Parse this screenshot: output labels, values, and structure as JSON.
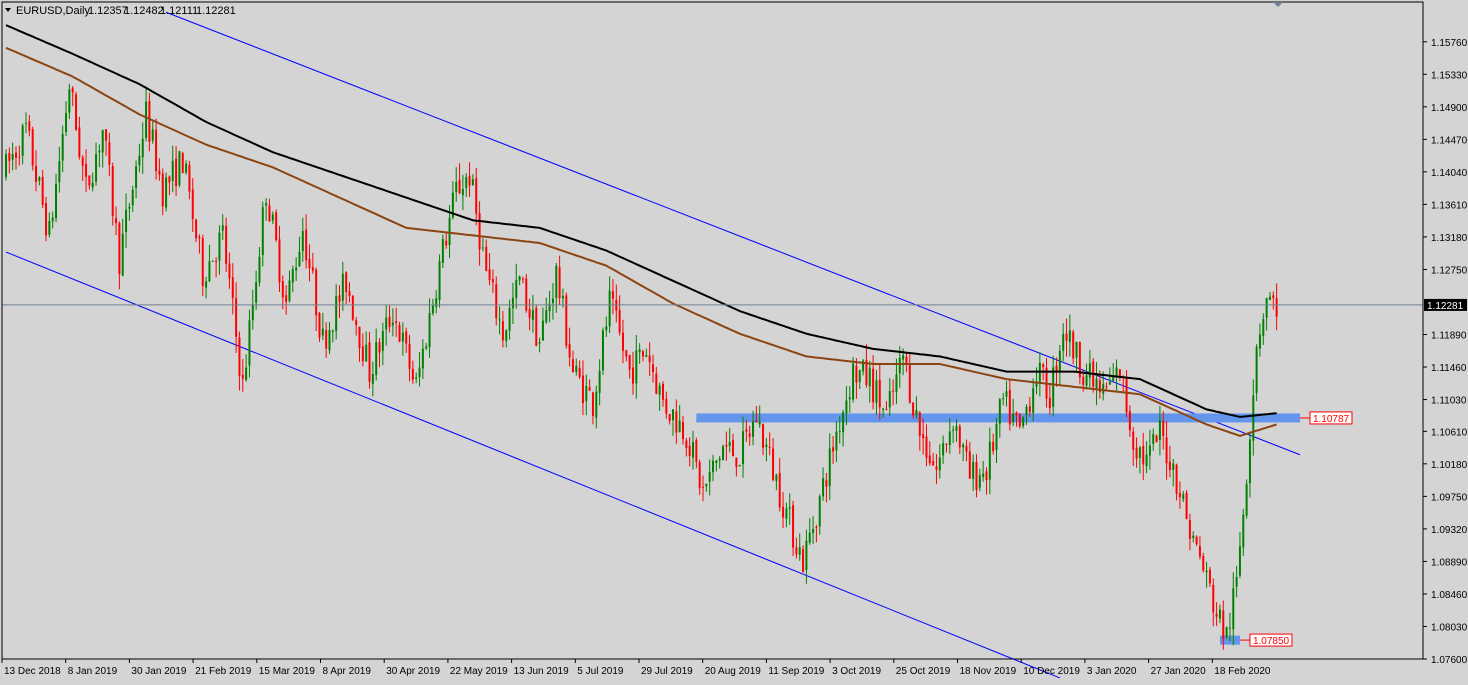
{
  "chart_data": {
    "type": "candlestick",
    "title": "EURUSD,Daily",
    "ohlc_readout": [
      "1.12357",
      "1.12482",
      "1.12111",
      "1.12281"
    ],
    "ylim": [
      1.076,
      1.1618
    ],
    "y_ticks": [
      "1.15760",
      "1.15330",
      "1.14900",
      "1.14470",
      "1.14040",
      "1.13610",
      "1.13180",
      "1.12750",
      "1.12281",
      "1.11890",
      "1.11460",
      "1.11030",
      "1.10610",
      "1.10180",
      "1.09750",
      "1.09320",
      "1.08890",
      "1.08460",
      "1.08030",
      "1.07600"
    ],
    "x_labels": [
      "13 Dec 2018",
      "8 Jan 2019",
      "30 Jan 2019",
      "21 Feb 2019",
      "15 Mar 2019",
      "8 Apr 2019",
      "30 Apr 2019",
      "22 May 2019",
      "13 Jun 2019",
      "5 Jul 2019",
      "29 Jul 2019",
      "20 Aug 2019",
      "11 Sep 2019",
      "3 Oct 2019",
      "25 Oct 2019",
      "18 Nov 2019",
      "10 Dec 2019",
      "3 Jan 2020",
      "27 Jan 2020",
      "18 Feb 2020"
    ],
    "current_price": "1.12281",
    "levels": [
      {
        "label": "1.10787",
        "value": 1.10787
      },
      {
        "label": "1.07850",
        "value": 1.0785
      }
    ],
    "colors": {
      "background": "#d4d4d4",
      "bull": "#008000",
      "bear": "#ff0000",
      "ma_slow": "#000000",
      "ma_fast": "#8b4513",
      "channel": "#0000ff",
      "level_band": "#6495ed",
      "price_line": "#708090",
      "level_label": "#ff0000"
    },
    "anchors": [
      [
        0,
        1.14
      ],
      [
        7,
        1.146
      ],
      [
        14,
        1.132
      ],
      [
        20,
        1.152
      ],
      [
        25,
        1.138
      ],
      [
        30,
        1.146
      ],
      [
        35,
        1.129
      ],
      [
        43,
        1.148
      ],
      [
        48,
        1.138
      ],
      [
        54,
        1.142
      ],
      [
        60,
        1.127
      ],
      [
        66,
        1.132
      ],
      [
        72,
        1.112
      ],
      [
        79,
        1.138
      ],
      [
        85,
        1.123
      ],
      [
        90,
        1.133
      ],
      [
        96,
        1.118
      ],
      [
        103,
        1.126
      ],
      [
        110,
        1.114
      ],
      [
        117,
        1.122
      ],
      [
        124,
        1.112
      ],
      [
        131,
        1.128
      ],
      [
        136,
        1.138
      ],
      [
        140,
        1.14
      ],
      [
        145,
        1.127
      ],
      [
        150,
        1.119
      ],
      [
        155,
        1.126
      ],
      [
        161,
        1.118
      ],
      [
        166,
        1.127
      ],
      [
        171,
        1.114
      ],
      [
        177,
        1.11
      ],
      [
        182,
        1.123
      ],
      [
        188,
        1.114
      ],
      [
        193,
        1.117
      ],
      [
        198,
        1.11
      ],
      [
        205,
        1.106
      ],
      [
        210,
        1.098
      ],
      [
        216,
        1.104
      ],
      [
        221,
        1.103
      ],
      [
        226,
        1.108
      ],
      [
        231,
        1.101
      ],
      [
        236,
        1.094
      ],
      [
        240,
        1.089
      ],
      [
        245,
        1.097
      ],
      [
        250,
        1.106
      ],
      [
        255,
        1.114
      ],
      [
        260,
        1.113
      ],
      [
        265,
        1.108
      ],
      [
        270,
        1.116
      ],
      [
        275,
        1.106
      ],
      [
        280,
        1.101
      ],
      [
        285,
        1.108
      ],
      [
        290,
        1.1
      ],
      [
        295,
        1.101
      ],
      [
        300,
        1.11
      ],
      [
        305,
        1.106
      ],
      [
        310,
        1.114
      ],
      [
        314,
        1.111
      ],
      [
        318,
        1.12
      ],
      [
        322,
        1.116
      ],
      [
        326,
        1.113
      ],
      [
        330,
        1.111
      ],
      [
        335,
        1.114
      ],
      [
        339,
        1.105
      ],
      [
        343,
        1.102
      ],
      [
        347,
        1.106
      ],
      [
        352,
        1.1
      ],
      [
        356,
        1.093
      ],
      [
        360,
        1.088
      ],
      [
        364,
        1.082
      ],
      [
        367,
        1.079
      ],
      [
        370,
        1.086
      ],
      [
        373,
        1.101
      ],
      [
        376,
        1.118
      ],
      [
        379,
        1.124
      ],
      [
        381,
        1.1228
      ]
    ],
    "ma_slow_anchors": [
      [
        0,
        1.1598
      ],
      [
        20,
        1.156
      ],
      [
        40,
        1.152
      ],
      [
        60,
        1.147
      ],
      [
        80,
        1.143
      ],
      [
        100,
        1.14
      ],
      [
        120,
        1.137
      ],
      [
        140,
        1.134
      ],
      [
        160,
        1.133
      ],
      [
        180,
        1.13
      ],
      [
        200,
        1.126
      ],
      [
        220,
        1.122
      ],
      [
        240,
        1.119
      ],
      [
        260,
        1.117
      ],
      [
        280,
        1.116
      ],
      [
        300,
        1.114
      ],
      [
        320,
        1.114
      ],
      [
        340,
        1.113
      ],
      [
        350,
        1.111
      ],
      [
        360,
        1.109
      ],
      [
        370,
        1.108
      ],
      [
        381,
        1.1085
      ]
    ],
    "ma_fast_anchors": [
      [
        0,
        1.1568
      ],
      [
        20,
        1.153
      ],
      [
        40,
        1.148
      ],
      [
        60,
        1.144
      ],
      [
        80,
        1.141
      ],
      [
        100,
        1.137
      ],
      [
        120,
        1.133
      ],
      [
        140,
        1.132
      ],
      [
        160,
        1.131
      ],
      [
        180,
        1.128
      ],
      [
        200,
        1.123
      ],
      [
        220,
        1.119
      ],
      [
        240,
        1.116
      ],
      [
        260,
        1.115
      ],
      [
        280,
        1.115
      ],
      [
        300,
        1.113
      ],
      [
        320,
        1.112
      ],
      [
        340,
        1.111
      ],
      [
        350,
        1.109
      ],
      [
        360,
        1.107
      ],
      [
        370,
        1.1055
      ],
      [
        381,
        1.107
      ]
    ],
    "channel_lines": [
      {
        "name": "upper",
        "from": [
          48,
          1.1615
        ],
        "to": [
          388,
          1.103
        ]
      },
      {
        "name": "lower",
        "from": [
          0,
          1.1298
        ],
        "to": [
          316,
          1.0735
        ]
      }
    ],
    "level_bands": [
      {
        "value": 1.10787,
        "from": 207,
        "to": 388
      },
      {
        "value": 1.0785,
        "from": 364,
        "to": 370
      }
    ],
    "n_bars": 382
  }
}
